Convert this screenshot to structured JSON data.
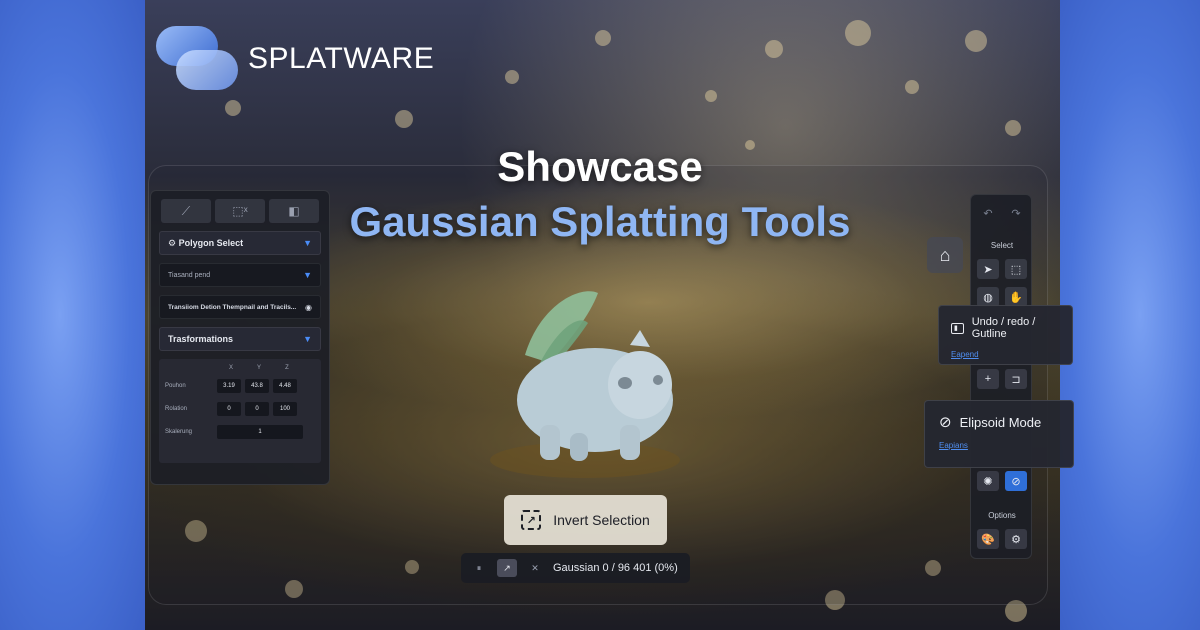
{
  "brand": {
    "name": "SPLATWARE"
  },
  "headline": {
    "line1": "Showcase",
    "line2": "Gaussian Splatting Tools"
  },
  "left_panel": {
    "tabs": [
      "⟋",
      "⬚ˣ",
      "◧"
    ],
    "tool_header": "Polygon Select",
    "dropdown_value": "Tiasand pend",
    "transform_row": "Transiiom Detion Thempnail and Tracils...",
    "section_title": "Trasformations",
    "grid": {
      "columns": [
        "X",
        "Y",
        "Z"
      ],
      "rows": [
        {
          "label": "Pouhon",
          "values": [
            "3.19",
            "43.8",
            "4.48"
          ]
        },
        {
          "label": "Rolation",
          "values": [
            "0",
            "0",
            "100"
          ]
        },
        {
          "label": "Skalerung",
          "values": [
            "1"
          ]
        }
      ]
    }
  },
  "right_toolbar": {
    "select_label": "Select",
    "options_label": "Options"
  },
  "tooltips": {
    "undo": {
      "title": "Undo / redo / Gutline",
      "link": "Eapend"
    },
    "ellipsoid": {
      "title": "Elipsoid Mode",
      "link": "Eapians"
    }
  },
  "invert_button": {
    "label": "Invert Selection"
  },
  "status_bar": {
    "text": "Gaussian 0 / 96 401 (0%)"
  },
  "colors": {
    "accent": "#4f8ef0",
    "headline_blue": "#8fb6f3",
    "panel_bg": "#1c1e26"
  }
}
